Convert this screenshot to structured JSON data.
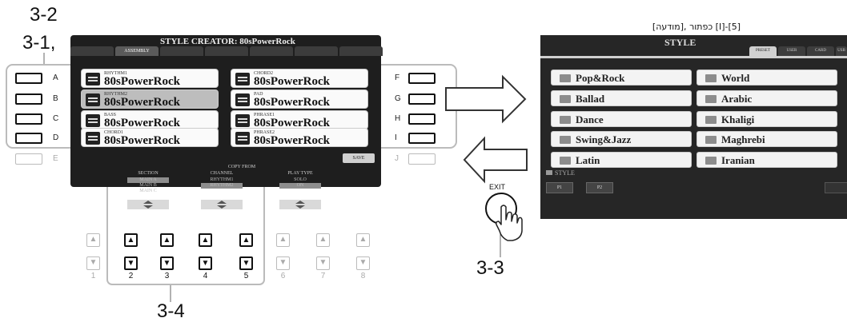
{
  "callouts": {
    "c32": "3-2",
    "c31": "3-1,",
    "c33": "3-3",
    "c34": "3-4"
  },
  "note_hebrew": "[מודעה], כפתור [I]-[5]",
  "left": {
    "title": "STYLE CREATOR: 80sPowerRock",
    "tabs": [
      "",
      "ASSEMBLY",
      "",
      "",
      "",
      "",
      ""
    ],
    "parts": [
      {
        "label": "RHYTHM1",
        "name": "80sPowerRock",
        "selected": false
      },
      {
        "label": "RHYTHM2",
        "name": "80sPowerRock",
        "selected": true
      },
      {
        "label": "BASS",
        "name": "80sPowerRock",
        "selected": false
      },
      {
        "label": "CHORD1",
        "name": "80sPowerRock",
        "selected": false
      },
      {
        "label": "CHORD2",
        "name": "80sPowerRock",
        "selected": false
      },
      {
        "label": "PAD",
        "name": "80sPowerRock",
        "selected": false
      },
      {
        "label": "PHRASE1",
        "name": "80sPowerRock",
        "selected": false
      },
      {
        "label": "PHRASE2",
        "name": "80sPowerRock",
        "selected": false
      }
    ],
    "left_buttons": [
      "A",
      "B",
      "C",
      "D",
      "E"
    ],
    "right_buttons": [
      "F",
      "G",
      "H",
      "I",
      "J"
    ],
    "save_label": "SAVE",
    "copy_from": {
      "header": "COPY FROM",
      "section": {
        "label": "SECTION",
        "values": [
          "MAIN A",
          "MAIN B",
          "MAIN C"
        ]
      },
      "channel": {
        "label": "CHANNEL",
        "values": [
          "RHYTHM1",
          "RHYTHM2"
        ]
      },
      "play_type": {
        "label": "PLAY TYPE",
        "values": [
          "SOLO",
          "ON"
        ]
      }
    },
    "numbers": [
      "1",
      "2",
      "3",
      "4",
      "5",
      "6",
      "7",
      "8"
    ]
  },
  "exit_label": "EXIT",
  "right": {
    "title": "STYLE",
    "tabs": [
      "PRESET",
      "USER",
      "CARD",
      "USB"
    ],
    "folders_left": [
      "Pop&Rock",
      "Ballad",
      "Dance",
      "Swing&Jazz",
      "Latin"
    ],
    "folders_right": [
      "World",
      "Arabic",
      "Khaligi",
      "Maghrebi",
      "Iranian"
    ],
    "footer_label": "STYLE",
    "pages": [
      "P1",
      "P2"
    ]
  }
}
